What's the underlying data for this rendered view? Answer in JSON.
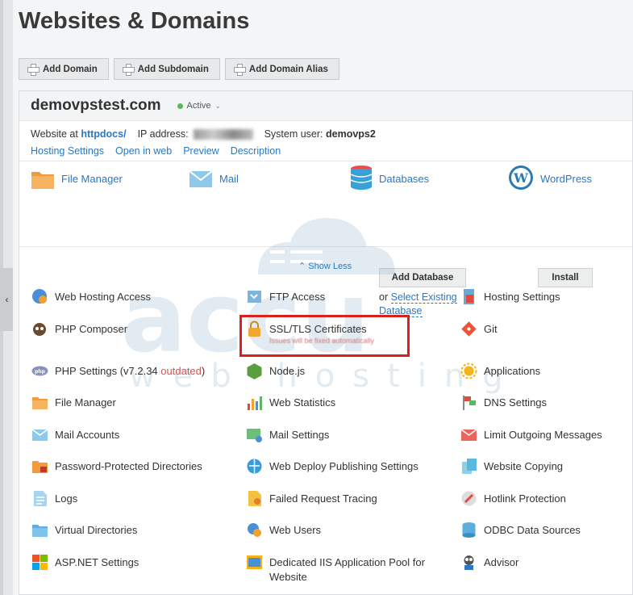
{
  "page": {
    "title": "Websites & Domains"
  },
  "toolbar": {
    "add_domain": "Add Domain",
    "add_subdomain": "Add Subdomain",
    "add_alias": "Add Domain Alias"
  },
  "domain": {
    "name": "demovpstest.com",
    "status": "Active",
    "website_at_label": "Website at",
    "website_path": "httpdocs/",
    "ip_label": "IP address:",
    "system_user_label": "System user:",
    "system_user": "demovps2"
  },
  "links": [
    "Hosting Settings",
    "Open in web",
    "Preview",
    "Description"
  ],
  "quick": {
    "file_manager": "File Manager",
    "mail": "Mail",
    "databases": "Databases",
    "add_database": "Add Database",
    "or": "or",
    "select_existing_1": "Select Existing",
    "select_existing_2": "Database",
    "wordpress": "WordPress",
    "install": "Install"
  },
  "show_less": "Show Less",
  "items": [
    {
      "label": "Web Hosting Access",
      "icon": "globe-user-icon"
    },
    {
      "label": "FTP Access",
      "icon": "ftp-icon"
    },
    {
      "label": "Hosting Settings",
      "icon": "hosting-settings-icon"
    },
    {
      "label": "PHP Composer",
      "icon": "composer-icon"
    },
    {
      "label": "SSL/TLS Certificates",
      "icon": "ssl-lock-icon"
    },
    {
      "label": "Git",
      "icon": "git-icon"
    },
    {
      "label": "PHP Settings (v7.2.34 ",
      "icon": "php-icon"
    },
    {
      "label": "Node.js",
      "icon": "nodejs-icon"
    },
    {
      "label": "Applications",
      "icon": "applications-icon"
    },
    {
      "label": "File Manager",
      "icon": "folder-icon"
    },
    {
      "label": "Web Statistics",
      "icon": "statistics-icon"
    },
    {
      "label": "DNS Settings",
      "icon": "dns-icon"
    },
    {
      "label": "Mail Accounts",
      "icon": "mail-accounts-icon"
    },
    {
      "label": "Mail Settings",
      "icon": "mail-settings-icon"
    },
    {
      "label": "Limit Outgoing Messages",
      "icon": "limit-mail-icon"
    },
    {
      "label": "Password-Protected Directories",
      "icon": "protected-folder-icon"
    },
    {
      "label": "Web Deploy Publishing Settings",
      "icon": "web-deploy-icon"
    },
    {
      "label": "Website Copying",
      "icon": "copy-icon"
    },
    {
      "label": "Logs",
      "icon": "logs-icon"
    },
    {
      "label": "Failed Request Tracing",
      "icon": "tracing-icon"
    },
    {
      "label": "Hotlink Protection",
      "icon": "hotlink-icon"
    },
    {
      "label": "Virtual Directories",
      "icon": "virtual-dir-icon"
    },
    {
      "label": "Web Users",
      "icon": "web-users-icon"
    },
    {
      "label": "ODBC Data Sources",
      "icon": "odbc-icon"
    },
    {
      "label": "ASP.NET Settings",
      "icon": "aspnet-icon"
    },
    {
      "label": "Dedicated IIS Application Pool for Website",
      "icon": "iis-pool-icon"
    },
    {
      "label": "Advisor",
      "icon": "advisor-icon"
    }
  ],
  "php_outdated": "outdated",
  "php_close": ")",
  "ssl_note": "Issues will be fixed automatically",
  "watermark": "web hosting"
}
